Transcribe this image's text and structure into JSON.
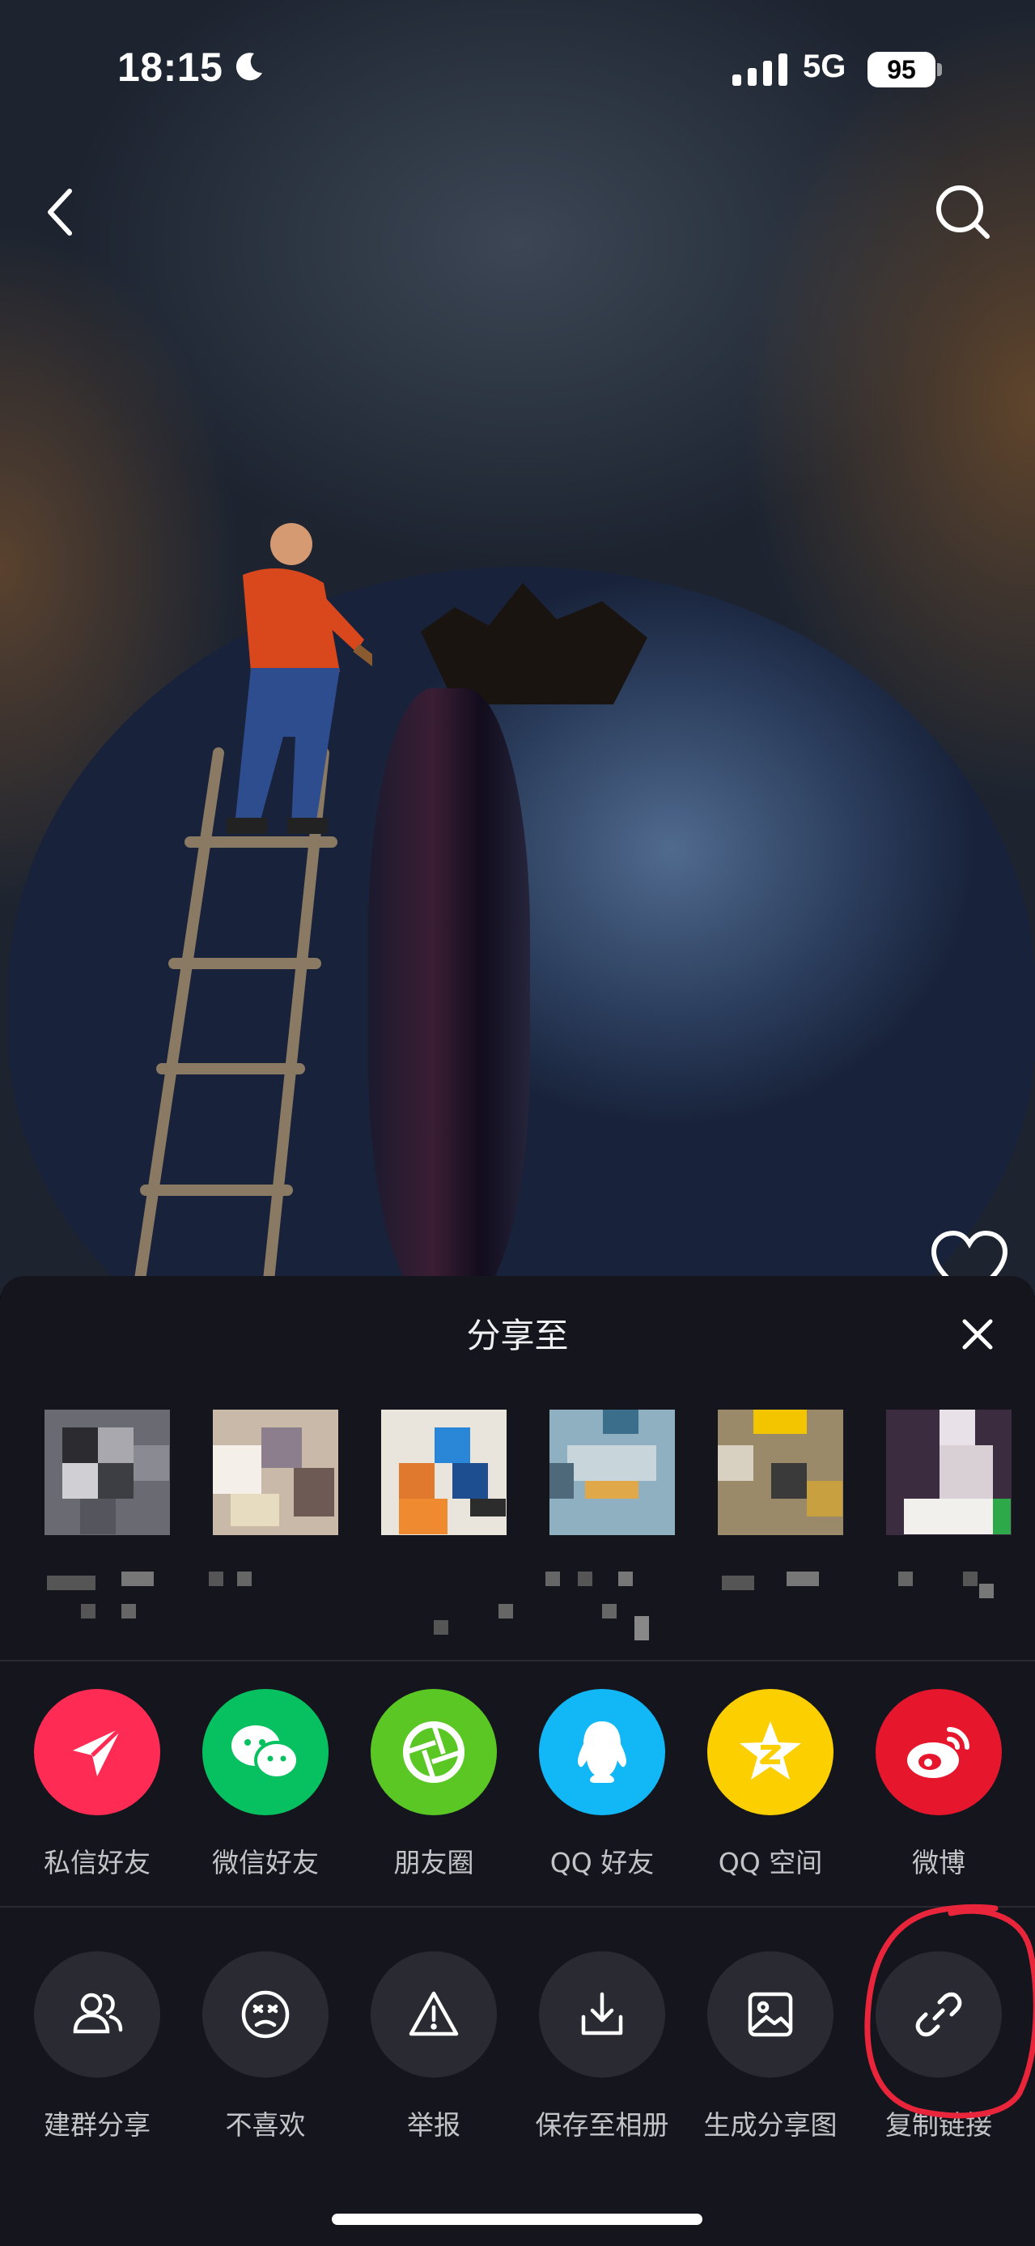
{
  "status_bar": {
    "time": "18:15",
    "network": "5G",
    "battery": "95"
  },
  "share_sheet": {
    "title": "分享至",
    "share_targets": [
      {
        "label": "私信好友",
        "icon": "paper-plane-icon",
        "color": "#fe2c55"
      },
      {
        "label": "微信好友",
        "icon": "wechat-icon",
        "color": "#07c160"
      },
      {
        "label": "朋友圈",
        "icon": "moments-aperture-icon",
        "color": "#5ac725"
      },
      {
        "label": "QQ 好友",
        "icon": "qq-penguin-icon",
        "color": "#12b7f5"
      },
      {
        "label": "QQ 空间",
        "icon": "qzone-star-icon",
        "color": "#fccf00"
      },
      {
        "label": "微博",
        "icon": "weibo-icon",
        "color": "#e6162d"
      }
    ],
    "actions": [
      {
        "label": "建群分享",
        "icon": "group-users-icon"
      },
      {
        "label": "不喜欢",
        "icon": "dislike-face-icon"
      },
      {
        "label": "举报",
        "icon": "report-warning-icon"
      },
      {
        "label": "保存至相册",
        "icon": "download-icon"
      },
      {
        "label": "生成分享图",
        "icon": "image-icon"
      },
      {
        "label": "复制链接",
        "icon": "link-icon"
      }
    ]
  }
}
